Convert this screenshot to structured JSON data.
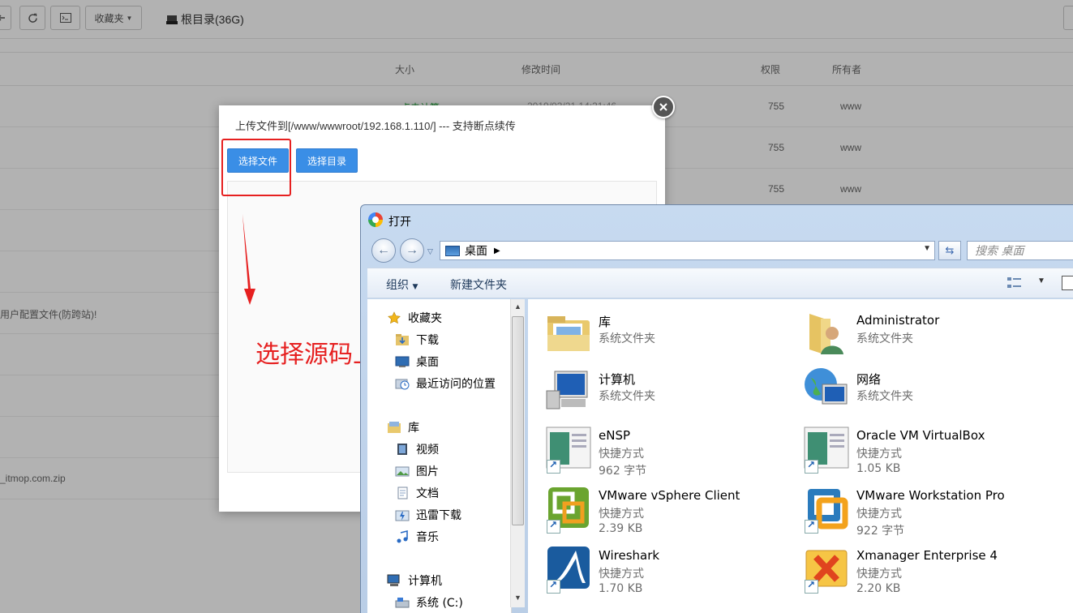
{
  "toolbar": {
    "favorites_label": "收藏夹",
    "breadcrumb": "根目录(36G)"
  },
  "table": {
    "columns": {
      "size": "大小",
      "modified": "修改时间",
      "perm": "权限",
      "owner": "所有者"
    },
    "rows": [
      {
        "name": "",
        "size": "点击计算",
        "time": "2019/03/21 14:31:46",
        "perm": "755",
        "owner": "www"
      },
      {
        "name": "",
        "size": "",
        "time": "",
        "perm": "755",
        "owner": "www"
      },
      {
        "name": "",
        "size": "",
        "time": "",
        "perm": "755",
        "owner": "www"
      },
      {
        "name": "",
        "size": "",
        "time": "",
        "perm": "755",
        "owner": "www"
      },
      {
        "name": "",
        "size": "",
        "time": "",
        "perm": "",
        "owner": ""
      },
      {
        "name": "用户配置文件(防跨站)!",
        "size": "",
        "time": "",
        "perm": "",
        "owner": ""
      },
      {
        "name": "",
        "size": "",
        "time": "",
        "perm": "",
        "owner": ""
      },
      {
        "name": "",
        "size": "",
        "time": "",
        "perm": "",
        "owner": ""
      },
      {
        "name": "",
        "size": "",
        "time": "",
        "perm": "",
        "owner": ""
      },
      {
        "name": "_itmop.com.zip",
        "size": "",
        "time": "",
        "perm": "",
        "owner": ""
      }
    ]
  },
  "upload": {
    "title": "上传文件到[/www/wwwroot/192.168.1.110/] --- 支持断点续传",
    "choose_file": "选择文件",
    "choose_dir": "选择目录"
  },
  "annotation": "选择源码上传",
  "open_dialog": {
    "title": "打开",
    "address": "桌面",
    "search_placeholder": "搜索 桌面",
    "organize": "组织",
    "new_folder": "新建文件夹",
    "nav": {
      "favorites": "收藏夹",
      "downloads": "下载",
      "desktop": "桌面",
      "recent": "最近访问的位置",
      "libraries": "库",
      "videos": "视频",
      "pictures": "图片",
      "documents": "文档",
      "thunder": "迅雷下载",
      "music": "音乐",
      "computer": "计算机",
      "system_drive": "系统 (C:)"
    },
    "items": [
      {
        "name": "库",
        "type": "系统文件夹",
        "size": ""
      },
      {
        "name": "Administrator",
        "type": "系统文件夹",
        "size": ""
      },
      {
        "name": "计算机",
        "type": "系统文件夹",
        "size": ""
      },
      {
        "name": "网络",
        "type": "系统文件夹",
        "size": ""
      },
      {
        "name": "eNSP",
        "type": "快捷方式",
        "size": "962 字节"
      },
      {
        "name": "Oracle VM VirtualBox",
        "type": "快捷方式",
        "size": "1.05 KB"
      },
      {
        "name": "VMware vSphere Client",
        "type": "快捷方式",
        "size": "2.39 KB"
      },
      {
        "name": "VMware Workstation Pro",
        "type": "快捷方式",
        "size": "922 字节"
      },
      {
        "name": "Wireshark",
        "type": "快捷方式",
        "size": "1.70 KB"
      },
      {
        "name": "Xmanager Enterprise 4",
        "type": "快捷方式",
        "size": "2.20 KB"
      }
    ]
  }
}
